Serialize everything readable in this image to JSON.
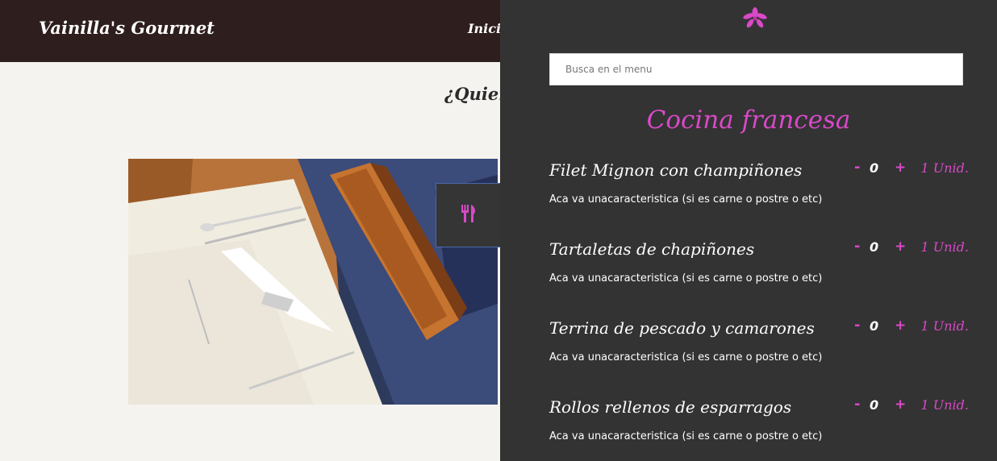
{
  "colors": {
    "header_bg": "#2f1e1e",
    "panel_bg": "#333333",
    "accent": "#d949c8",
    "page_bg": "#f5f3ef"
  },
  "header": {
    "brand": "Vainilla's Gourmet",
    "nav": [
      {
        "label": "Inicio"
      }
    ]
  },
  "main": {
    "heading": "¿Quien",
    "image": {
      "description_icon": "restaurant-table-photo"
    }
  },
  "menu_tab": {
    "icon": "utensils-icon"
  },
  "panel": {
    "logo_icon": "orchid-flower-icon",
    "search": {
      "placeholder": "Busca en el menu",
      "value": ""
    },
    "section_title": "Cocina francesa",
    "items": [
      {
        "name": "Filet Mignon con champiñones",
        "description": "Aca va unacaracteristica (si es carne o postre o etc)",
        "quantity": "0",
        "unit": "1 Unid.",
        "minus": "-",
        "plus": "+"
      },
      {
        "name": "Tartaletas de chapiñones",
        "description": "Aca va unacaracteristica (si es carne o postre o etc)",
        "quantity": "0",
        "unit": "1 Unid.",
        "minus": "-",
        "plus": "+"
      },
      {
        "name": "Terrina de pescado y camarones",
        "description": "Aca va unacaracteristica (si es carne o postre o etc)",
        "quantity": "0",
        "unit": "1 Unid.",
        "minus": "-",
        "plus": "+"
      },
      {
        "name": "Rollos rellenos de esparragos",
        "description": "Aca va unacaracteristica (si es carne o postre o etc)",
        "quantity": "0",
        "unit": "1 Unid.",
        "minus": "-",
        "plus": "+"
      }
    ]
  }
}
